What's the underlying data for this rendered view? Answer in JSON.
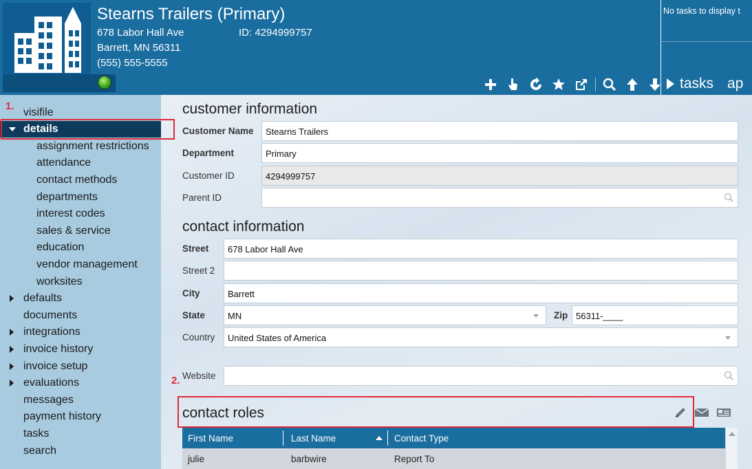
{
  "header": {
    "customer_title": "Stearns Trailers (Primary)",
    "address_line1": "678 Labor Hall Ave",
    "address_line2": "Barrett, MN   56311",
    "phone": "(555) 555-5555",
    "id_text": "ID:  4294999757",
    "status_color": "#3ea51b",
    "toolbar_icons": [
      "plus-icon",
      "pointer-icon",
      "refresh-icon",
      "star-icon",
      "external-link-icon",
      "search-icon",
      "arrow-up-icon",
      "arrow-down-icon"
    ]
  },
  "tasks_panel": {
    "empty_text": "No tasks to display t",
    "tasks_label": "tasks",
    "apps_label": "ap"
  },
  "sidebar": {
    "items": [
      {
        "label": "visifile"
      },
      {
        "label": "details"
      },
      {
        "label": "assignment restrictions"
      },
      {
        "label": "attendance"
      },
      {
        "label": "contact methods"
      },
      {
        "label": "departments"
      },
      {
        "label": "interest codes"
      },
      {
        "label": "sales & service"
      },
      {
        "label": "education"
      },
      {
        "label": "vendor management"
      },
      {
        "label": "worksites"
      },
      {
        "label": "defaults"
      },
      {
        "label": "documents"
      },
      {
        "label": "integrations"
      },
      {
        "label": "invoice history"
      },
      {
        "label": "invoice setup"
      },
      {
        "label": "evaluations"
      },
      {
        "label": "messages"
      },
      {
        "label": "payment history"
      },
      {
        "label": "tasks"
      },
      {
        "label": "search"
      }
    ]
  },
  "annotations": {
    "step1": "1.",
    "step2": "2.",
    "color": "#e0293a"
  },
  "customer_info": {
    "title": "customer information",
    "customer_name_label": "Customer Name",
    "customer_name_value": "Stearns Trailers",
    "department_label": "Department",
    "department_value": "Primary",
    "customer_id_label": "Customer ID",
    "customer_id_value": "4294999757",
    "parent_id_label": "Parent ID",
    "parent_id_value": ""
  },
  "contact_info": {
    "title": "contact information",
    "street_label": "Street",
    "street_value": "678 Labor Hall Ave",
    "street2_label": "Street 2",
    "street2_value": "",
    "city_label": "City",
    "city_value": "Barrett",
    "state_label": "State",
    "state_value": "MN",
    "zip_label": "Zip",
    "zip_value": "56311-____",
    "country_label": "Country",
    "country_value": "United States of America",
    "website_label": "Website",
    "website_value": ""
  },
  "contact_roles": {
    "title": "contact roles",
    "columns": [
      "First Name",
      "Last Name",
      "Contact Type"
    ],
    "rows": [
      {
        "first_name": "julie",
        "last_name": "barbwire",
        "contact_type": "Report To"
      }
    ]
  },
  "colors": {
    "header_blue": "#1a6d9f",
    "sidebar_blue": "#a8cbe0",
    "selected_nav": "#0c3b5b"
  }
}
